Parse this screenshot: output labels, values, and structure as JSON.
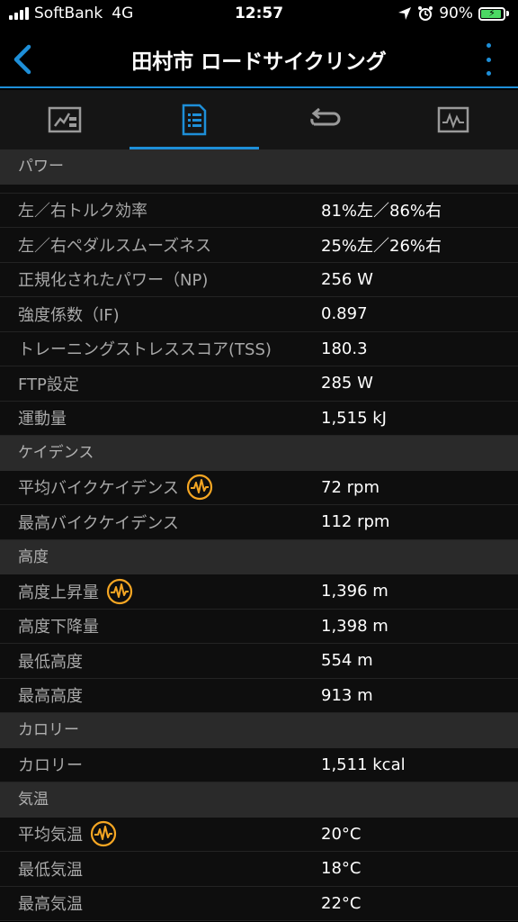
{
  "status_bar": {
    "carrier": "SoftBank",
    "network": "4G",
    "time": "12:57",
    "battery": "90%",
    "battery_level": 0.9
  },
  "header": {
    "title": "田村市 ロードサイクリング"
  },
  "tabs": [
    {
      "icon": "map-chart-icon",
      "active": false
    },
    {
      "icon": "document-list-icon",
      "active": true
    },
    {
      "icon": "laps-loop-icon",
      "active": false
    },
    {
      "icon": "activity-graph-icon",
      "active": false
    }
  ],
  "colors": {
    "accent": "#1e8fd8",
    "graph_icon": "#f5a623",
    "section_bg": "#2a2a2a"
  },
  "sections": {
    "power": {
      "title": "パワー",
      "rows": [
        {
          "label": "左／右トルク効率",
          "value": "81%左／86%右"
        },
        {
          "label": "左／右ペダルスムーズネス",
          "value": "25%左／26%右"
        },
        {
          "label": "正規化されたパワー（NP)",
          "value": "256 W"
        },
        {
          "label": "強度係数（IF)",
          "value": "0.897"
        },
        {
          "label": "トレーニングストレススコア(TSS)",
          "value": "180.3"
        },
        {
          "label": "FTP設定",
          "value": "285 W"
        },
        {
          "label": "運動量",
          "value": "1,515 kJ"
        }
      ]
    },
    "cadence": {
      "title": "ケイデンス",
      "rows": [
        {
          "label": "平均バイクケイデンス",
          "value": "72 rpm"
        },
        {
          "label": "最高バイクケイデンス",
          "value": "112 rpm"
        }
      ]
    },
    "elevation": {
      "title": "高度",
      "rows": [
        {
          "label": "高度上昇量",
          "value": "1,396 m"
        },
        {
          "label": "高度下降量",
          "value": "1,398 m"
        },
        {
          "label": "最低高度",
          "value": "554 m"
        },
        {
          "label": "最高高度",
          "value": "913 m"
        }
      ]
    },
    "calories": {
      "title": "カロリー",
      "rows": [
        {
          "label": "カロリー",
          "value": "1,511 kcal"
        }
      ]
    },
    "temperature": {
      "title": "気温",
      "rows": [
        {
          "label": "平均気温",
          "value": "20°C"
        },
        {
          "label": "最低気温",
          "value": "18°C"
        },
        {
          "label": "最高気温",
          "value": "22°C"
        }
      ]
    }
  }
}
